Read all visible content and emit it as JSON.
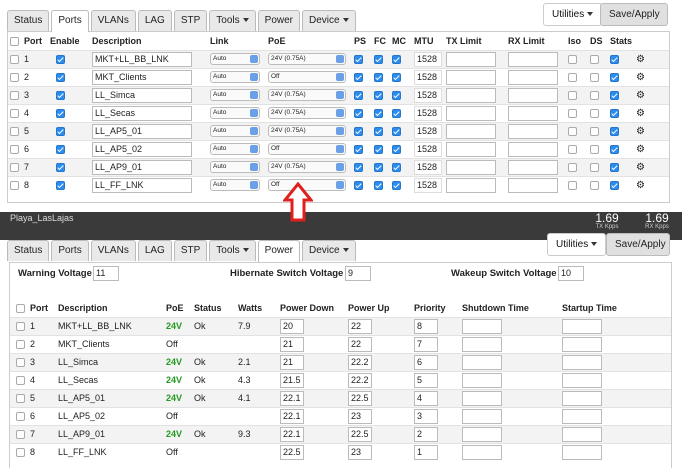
{
  "ports_view": {
    "tabs": [
      {
        "label": "Status"
      },
      {
        "label": "Ports"
      },
      {
        "label": "VLANs"
      },
      {
        "label": "LAG"
      },
      {
        "label": "STP"
      },
      {
        "label": "Tools"
      },
      {
        "label": "Power"
      },
      {
        "label": "Device"
      }
    ],
    "utilities_label": "Utilities",
    "save_label": "Save/Apply",
    "headers": {
      "port": "Port",
      "enable": "Enable",
      "description": "Description",
      "link": "Link",
      "poe": "PoE",
      "ps": "PS",
      "fc": "FC",
      "mc": "MC",
      "mtu": "MTU",
      "tx": "TX Limit",
      "rx": "RX Limit",
      "iso": "Iso",
      "ds": "DS",
      "stats": "Stats"
    },
    "rows": [
      {
        "port": "1",
        "description": "MKT+LL_BB_LNK",
        "link": "Auto",
        "poe": "24V (0.75A)",
        "mtu": "1528"
      },
      {
        "port": "2",
        "description": "MKT_Clients",
        "link": "Auto",
        "poe": "Off",
        "mtu": "1528"
      },
      {
        "port": "3",
        "description": "LL_Simca",
        "link": "Auto",
        "poe": "24V (0.75A)",
        "mtu": "1528"
      },
      {
        "port": "4",
        "description": "LL_Secas",
        "link": "Auto",
        "poe": "24V (0.75A)",
        "mtu": "1528"
      },
      {
        "port": "5",
        "description": "LL_AP5_01",
        "link": "Auto",
        "poe": "24V (0.75A)",
        "mtu": "1528"
      },
      {
        "port": "6",
        "description": "LL_AP5_02",
        "link": "Auto",
        "poe": "Off",
        "mtu": "1528"
      },
      {
        "port": "7",
        "description": "LL_AP9_01",
        "link": "Auto",
        "poe": "24V (0.75A)",
        "mtu": "1528"
      },
      {
        "port": "8",
        "description": "LL_FF_LNK",
        "link": "Auto",
        "poe": "Off",
        "mtu": "1528"
      }
    ]
  },
  "power_view": {
    "site": "Playa_LasLajas",
    "tx_rate": "1.69",
    "tx_unit": "TX Kpps",
    "rx_rate": "1.69",
    "rx_unit": "RX Kpps",
    "tabs": [
      {
        "label": "Status"
      },
      {
        "label": "Ports"
      },
      {
        "label": "VLANs"
      },
      {
        "label": "LAG"
      },
      {
        "label": "STP"
      },
      {
        "label": "Tools"
      },
      {
        "label": "Power"
      },
      {
        "label": "Device"
      }
    ],
    "utilities_label": "Utilities",
    "save_label": "Save/Apply",
    "warning_label": "Warning Voltage",
    "warning_value": "11",
    "hibernate_label": "Hibernate Switch Voltage",
    "hibernate_value": "9",
    "wakeup_label": "Wakeup Switch Voltage",
    "wakeup_value": "10",
    "headers": {
      "port": "Port",
      "description": "Description",
      "poe": "PoE",
      "status": "Status",
      "watts": "Watts",
      "power_down": "Power Down",
      "power_up": "Power Up",
      "priority": "Priority",
      "shutdown": "Shutdown Time",
      "startup": "Startup Time"
    },
    "rows": [
      {
        "port": "1",
        "description": "MKT+LL_BB_LNK",
        "poe": "24V",
        "status": "Ok",
        "watts": "7.9",
        "power_down": "20",
        "power_up": "22",
        "priority": "8"
      },
      {
        "port": "2",
        "description": "MKT_Clients",
        "poe": "Off",
        "status": "",
        "watts": "",
        "power_down": "21",
        "power_up": "22",
        "priority": "7"
      },
      {
        "port": "3",
        "description": "LL_Simca",
        "poe": "24V",
        "status": "Ok",
        "watts": "2.1",
        "power_down": "21",
        "power_up": "22.2",
        "priority": "6"
      },
      {
        "port": "4",
        "description": "LL_Secas",
        "poe": "24V",
        "status": "Ok",
        "watts": "4.3",
        "power_down": "21.5",
        "power_up": "22.2",
        "priority": "5"
      },
      {
        "port": "5",
        "description": "LL_AP5_01",
        "poe": "24V",
        "status": "Ok",
        "watts": "4.1",
        "power_down": "22.1",
        "power_up": "22.5",
        "priority": "4"
      },
      {
        "port": "6",
        "description": "LL_AP5_02",
        "poe": "Off",
        "status": "",
        "watts": "",
        "power_down": "22.1",
        "power_up": "23",
        "priority": "3"
      },
      {
        "port": "7",
        "description": "LL_AP9_01",
        "poe": "24V",
        "status": "Ok",
        "watts": "9.3",
        "power_down": "22.1",
        "power_up": "22.5",
        "priority": "2"
      },
      {
        "port": "8",
        "description": "LL_FF_LNK",
        "poe": "Off",
        "status": "",
        "watts": "",
        "power_down": "22.5",
        "power_up": "23",
        "priority": "1"
      }
    ]
  },
  "colors": {
    "accent": "#2d8cf0",
    "arrow": "#e0201c",
    "poe_on": "#229922"
  }
}
